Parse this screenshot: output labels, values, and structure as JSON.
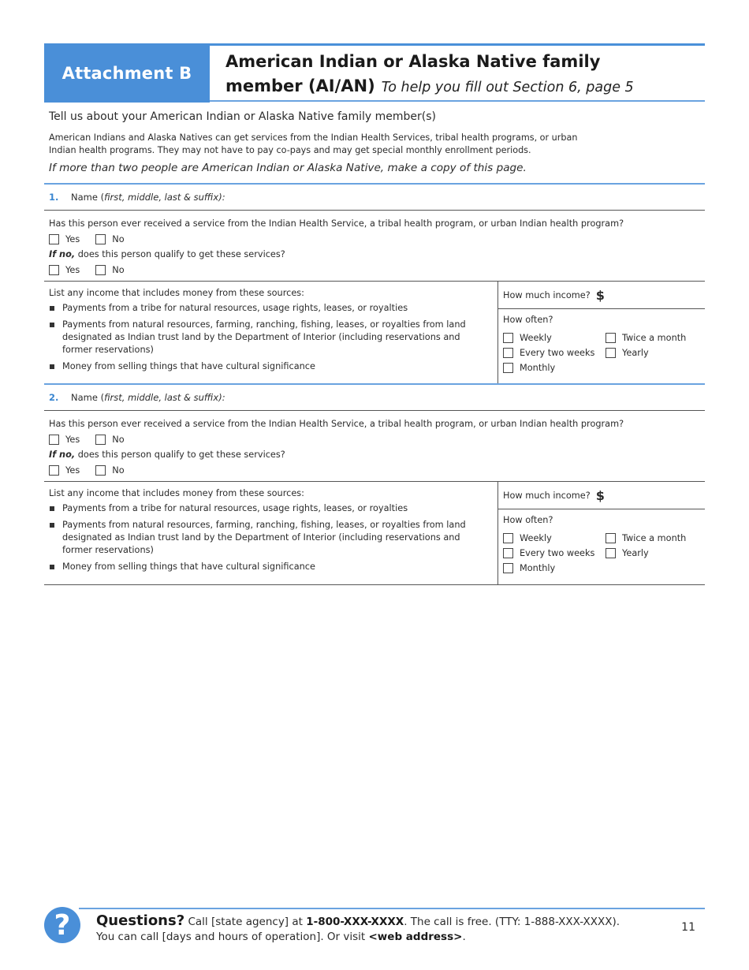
{
  "header": {
    "tab_label": "Attachment B",
    "title_line1": "American Indian or Alaska Native family",
    "title_line2": "member (AI/AN)",
    "subtitle": "To help you fill out Section 6, page 5"
  },
  "intro": {
    "title": "Tell us about your American Indian or Alaska Native family member(s)",
    "body_line1": "American Indians and Alaska Natives can get services from the Indian Health Services, tribal health programs, or urban",
    "body_line2": "Indian health programs. They may not have to pay co-pays and may get special monthly enrollment periods.",
    "note": "If more than two people are American Indian or Alaska Native, make a copy of this page."
  },
  "members": [
    {
      "number": "1.",
      "name_label": "Name (",
      "name_hint": "first, middle, last & suffix):",
      "q1": "Has this person ever received a service from the Indian Health Service, a tribal health program, or urban Indian health program?",
      "q1_options": [
        "Yes",
        "No"
      ],
      "q2_prefix": "If no,",
      "q2": " does this person qualify to get these services?",
      "q2_options": [
        "Yes",
        "No"
      ],
      "income_head": "List any income that includes money from these sources:",
      "income_items": [
        "Payments from a tribe for natural resources, usage rights, leases, or royalties",
        "Payments from natural resources, farming, ranching, fishing, leases, or royalties from land designated as Indian trust land by the Department of Interior (including reservations and former reservations)",
        "Money from selling things that have cultural significance"
      ],
      "how_much_label": "How much income?",
      "currency_symbol": "$",
      "how_often_label": "How often?",
      "frequency_options": [
        "Weekly",
        "Twice a month",
        "Every two weeks",
        "Yearly",
        "Monthly"
      ]
    },
    {
      "number": "2.",
      "name_label": "Name (",
      "name_hint": "first, middle, last & suffix):",
      "q1": "Has this person ever received a service from the Indian Health Service, a tribal health program, or urban Indian health program?",
      "q1_options": [
        "Yes",
        "No"
      ],
      "q2_prefix": "If no,",
      "q2": " does this person qualify to get these services?",
      "q2_options": [
        "Yes",
        "No"
      ],
      "income_head": "List any income that includes money from these sources:",
      "income_items": [
        "Payments from a tribe for natural resources, usage rights, leases, or royalties",
        "Payments from natural resources, farming, ranching, fishing, leases, or royalties from land designated as Indian trust land by the Department of Interior (including reservations and former reservations)",
        "Money from selling things that have cultural significance"
      ],
      "how_much_label": "How much income?",
      "currency_symbol": "$",
      "how_often_label": "How often?",
      "frequency_options": [
        "Weekly",
        "Twice a month",
        "Every two weeks",
        "Yearly",
        "Monthly"
      ]
    }
  ],
  "footer": {
    "icon": "question-icon",
    "icon_glyph": "?",
    "questions_label": "Questions?",
    "line1_a": " Call [state agency] at ",
    "phone": "1-800-XXX-XXXX",
    "line1_b": ". The call is free. (TTY: 1-888-XXX-XXXX).",
    "line2_a": "You can call [days and hours of operation]. Or visit ",
    "web": "<web address>",
    "line2_b": ".",
    "page_number": "11"
  },
  "colors": {
    "accent_blue": "#4a8fd8",
    "rule_blue": "#6aa3e0",
    "number_blue": "#3a86d0"
  }
}
